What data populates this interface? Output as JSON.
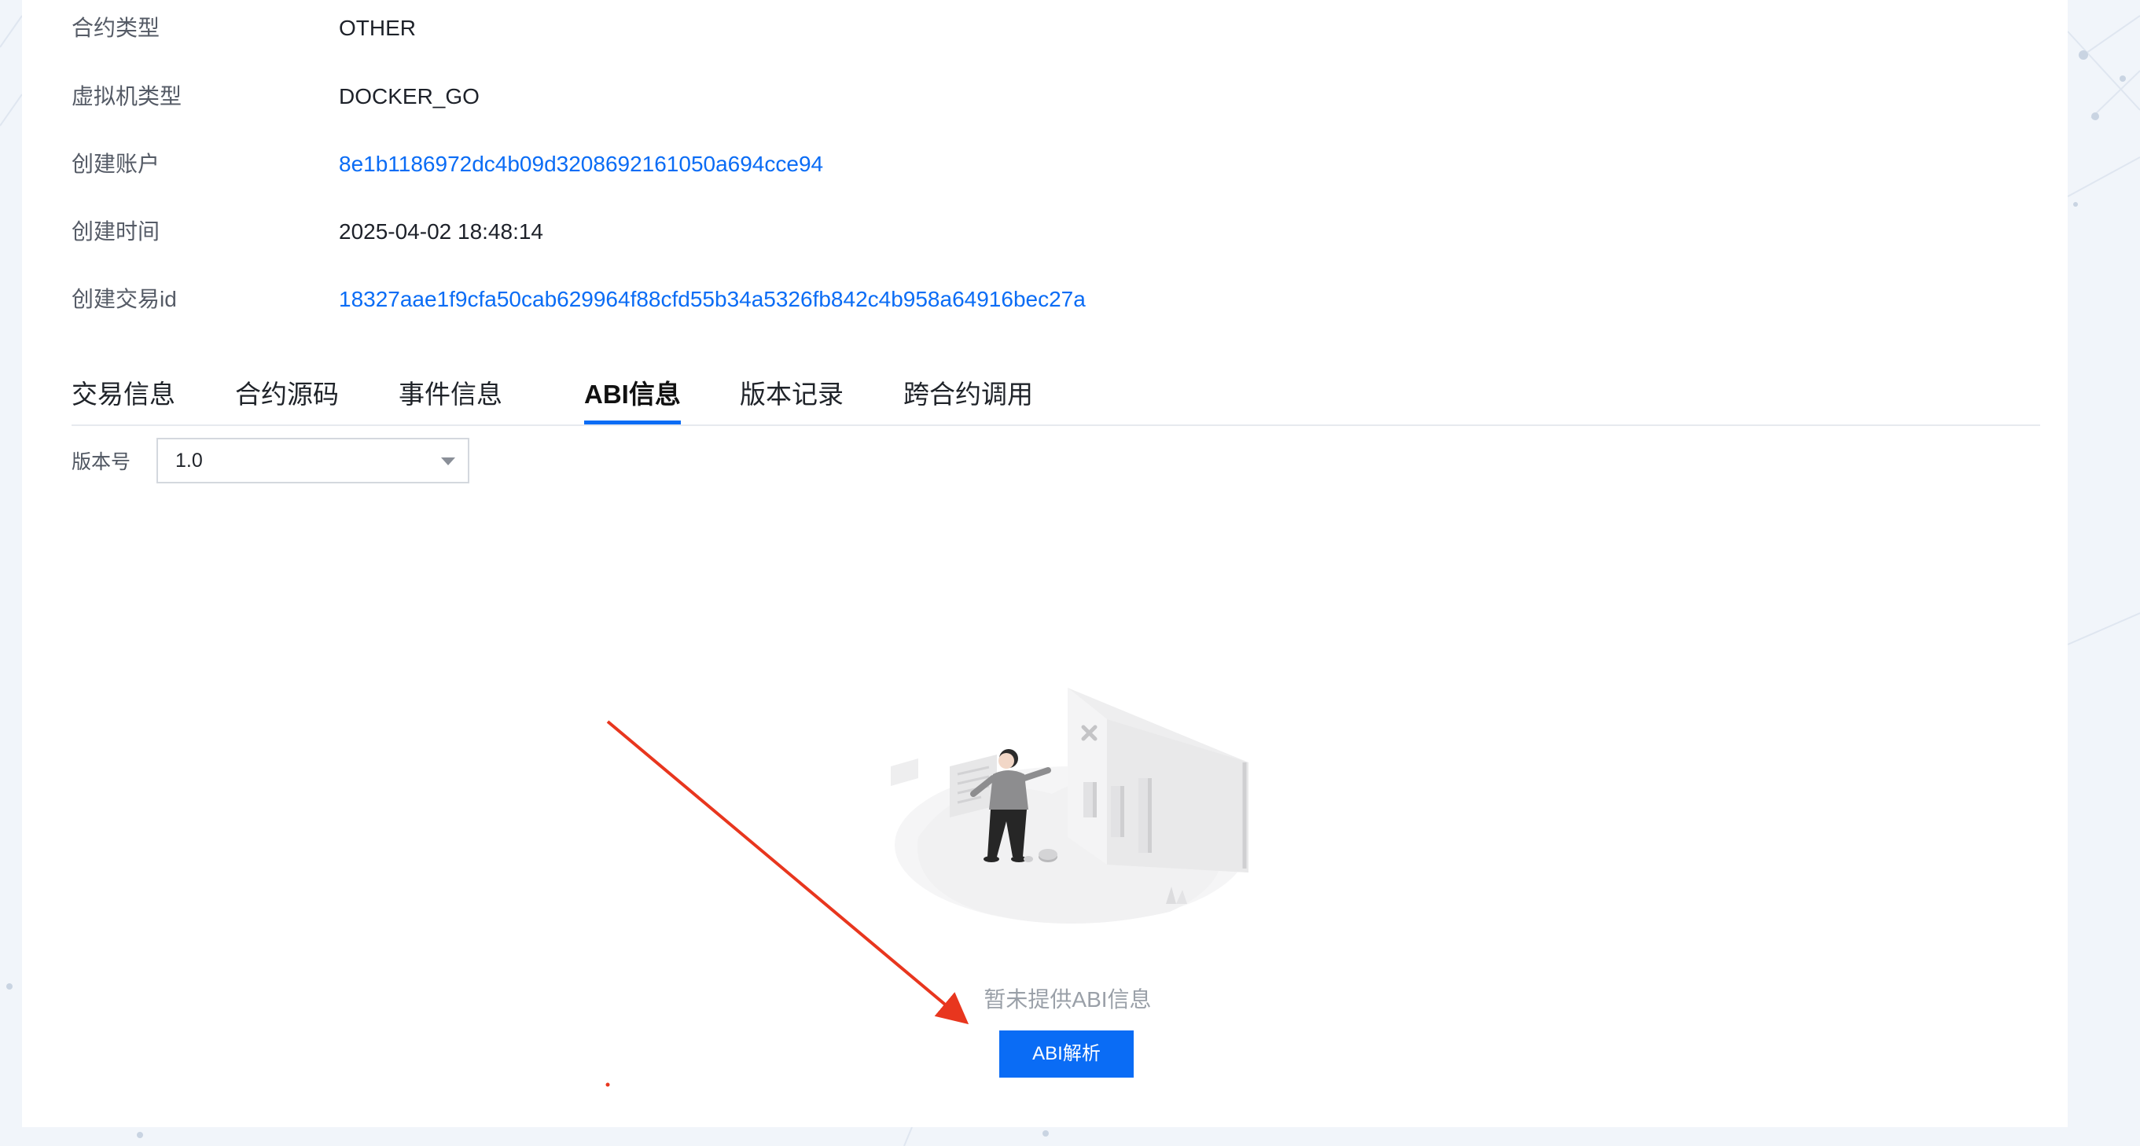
{
  "contract_info": {
    "rows": [
      {
        "label": "合约类型",
        "value": "OTHER"
      },
      {
        "label": "虚拟机类型",
        "value": "DOCKER_GO"
      },
      {
        "label": "创建账户",
        "value": "8e1b1186972dc4b09d3208692161050a694cce94"
      },
      {
        "label": "创建时间",
        "value": "2025-04-02 18:48:14"
      },
      {
        "label": "创建交易id",
        "value": "18327aae1f9cfa50cab629964f88cfd55b34a5326fb842c4b958a64916bec27a"
      }
    ]
  },
  "tabs": [
    {
      "label": "交易信息"
    },
    {
      "label": "合约源码"
    },
    {
      "label": "事件信息"
    },
    {
      "label": "ABI信息"
    },
    {
      "label": "版本记录"
    },
    {
      "label": "跨合约调用"
    }
  ],
  "active_tab": "ABI信息",
  "version_selector": {
    "label": "版本号",
    "value": "1.0"
  },
  "empty_state": {
    "message": "暂未提供ABI信息",
    "button_label": "ABI解析"
  },
  "colors": {
    "link": "#0a6cf5",
    "primary_button": "#0a6cf5",
    "annotation_arrow": "#e8361e"
  }
}
